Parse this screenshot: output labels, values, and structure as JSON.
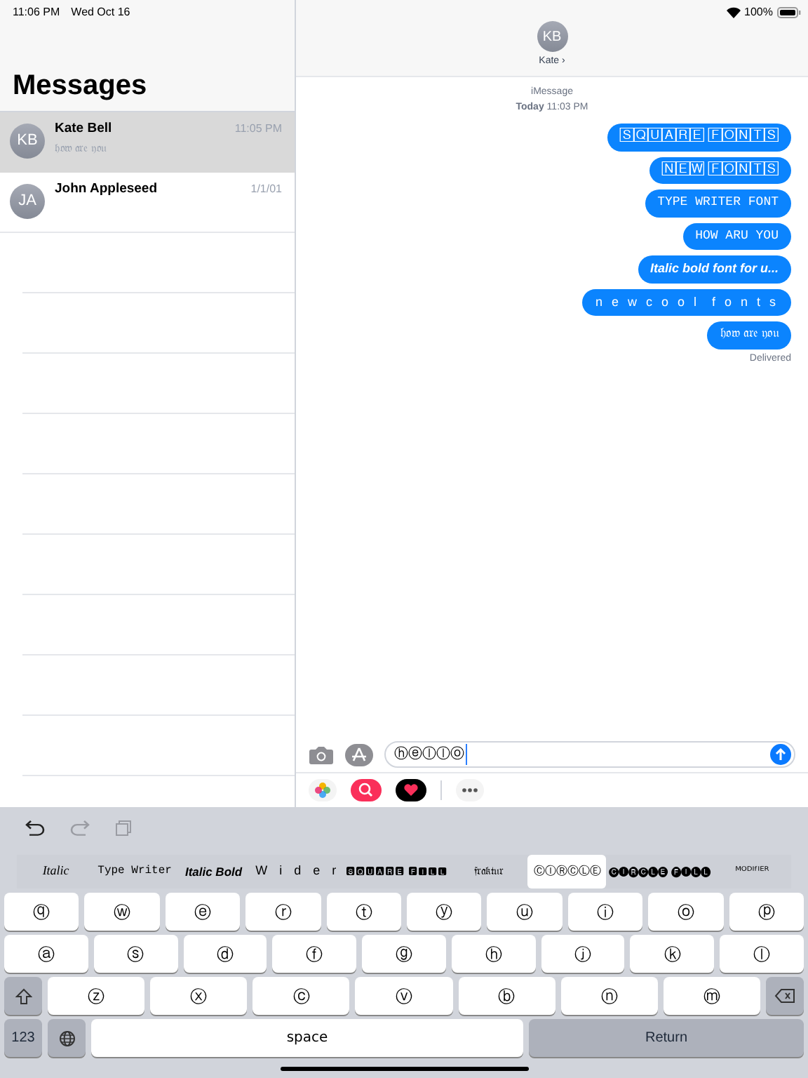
{
  "status_bar": {
    "time": "11:06 PM",
    "date": "Wed Oct 16",
    "battery": "100%"
  },
  "sidebar": {
    "title": "Messages",
    "conversations": [
      {
        "initials": "KB",
        "name": "Kate Bell",
        "preview": "𝔥𝔬𝔴 𝔞𝔯𝔢 𝔶𝔬𝔲",
        "time": "11:05 PM",
        "selected": true
      },
      {
        "initials": "JA",
        "name": "John Appleseed",
        "time": "1/1/01",
        "selected": false
      }
    ]
  },
  "conversation": {
    "contact": {
      "initials": "KB",
      "name": "Kate ›"
    },
    "service": "iMessage",
    "timestamp": "**Today** 11:03 PM",
    "messages": [
      {
        "text": "🅂🅀🅄🄰🅁🄴 🄵🄾🄽🅃🅂",
        "kind": "plain"
      },
      {
        "text": "🄽🄴🅆 🄵🄾🄽🅃🅂",
        "kind": "plain"
      },
      {
        "text": "TYPE WRITER FONT",
        "kind": "typewriter"
      },
      {
        "text": "HOW ARU YOU",
        "kind": "typewriter"
      },
      {
        "text": "Italic bold font for u...",
        "kind": "italicbold"
      },
      {
        "text": "n e w c o o l  f o n t s",
        "kind": "wide"
      },
      {
        "text": "𝔥𝔬𝔴 𝔞𝔯𝔢 𝔶𝔬𝔲",
        "kind": "plain"
      }
    ],
    "status": "Delivered"
  },
  "compose": {
    "value": "ⓗⓔⓛⓛⓞ"
  },
  "keyboard": {
    "font_styles": [
      {
        "label": "Italic",
        "kind": "italic",
        "selected": false
      },
      {
        "label": "Type Writer",
        "kind": "typewriter",
        "selected": false
      },
      {
        "label": "Italic Bold",
        "kind": "italicbold",
        "selected": false
      },
      {
        "label": "W i d e r",
        "kind": "wide",
        "selected": false
      },
      {
        "label": "🆂🆀🆄🅰🆁🅴 🅵🅸🅻🅻",
        "kind": "block",
        "selected": false
      },
      {
        "label": "𝔣𝔯𝔞𝔨𝔱𝔲𝔯",
        "kind": "plain",
        "selected": false
      },
      {
        "label": "ⒸⒾⓇⒸⓁⒺ",
        "kind": "plain",
        "selected": true
      },
      {
        "label": "🅒🅘🅡🅒🅛🅔 🅕🅘🅛🅛",
        "kind": "block",
        "selected": false
      },
      {
        "label": "ᴹᴼᴰᴵᶠᴵᴱᴿ",
        "kind": "plain",
        "selected": false
      }
    ],
    "top_row": [
      "ⓠ",
      "ⓦ",
      "ⓔ",
      "ⓡ",
      "ⓣ",
      "ⓨ",
      "ⓤ",
      "ⓘ",
      "ⓞ",
      "ⓟ"
    ],
    "middle_row": [
      "ⓐ",
      "ⓢ",
      "ⓓ",
      "ⓕ",
      "ⓖ",
      "ⓗ",
      "ⓙ",
      "ⓚ",
      "ⓛ"
    ],
    "bottom_row": [
      "ⓩ",
      "ⓧ",
      "ⓒ",
      "ⓥ",
      "ⓑ",
      "ⓝ",
      "ⓜ"
    ],
    "numbers_key": "123",
    "space_key": "space",
    "return_key": "Return"
  }
}
